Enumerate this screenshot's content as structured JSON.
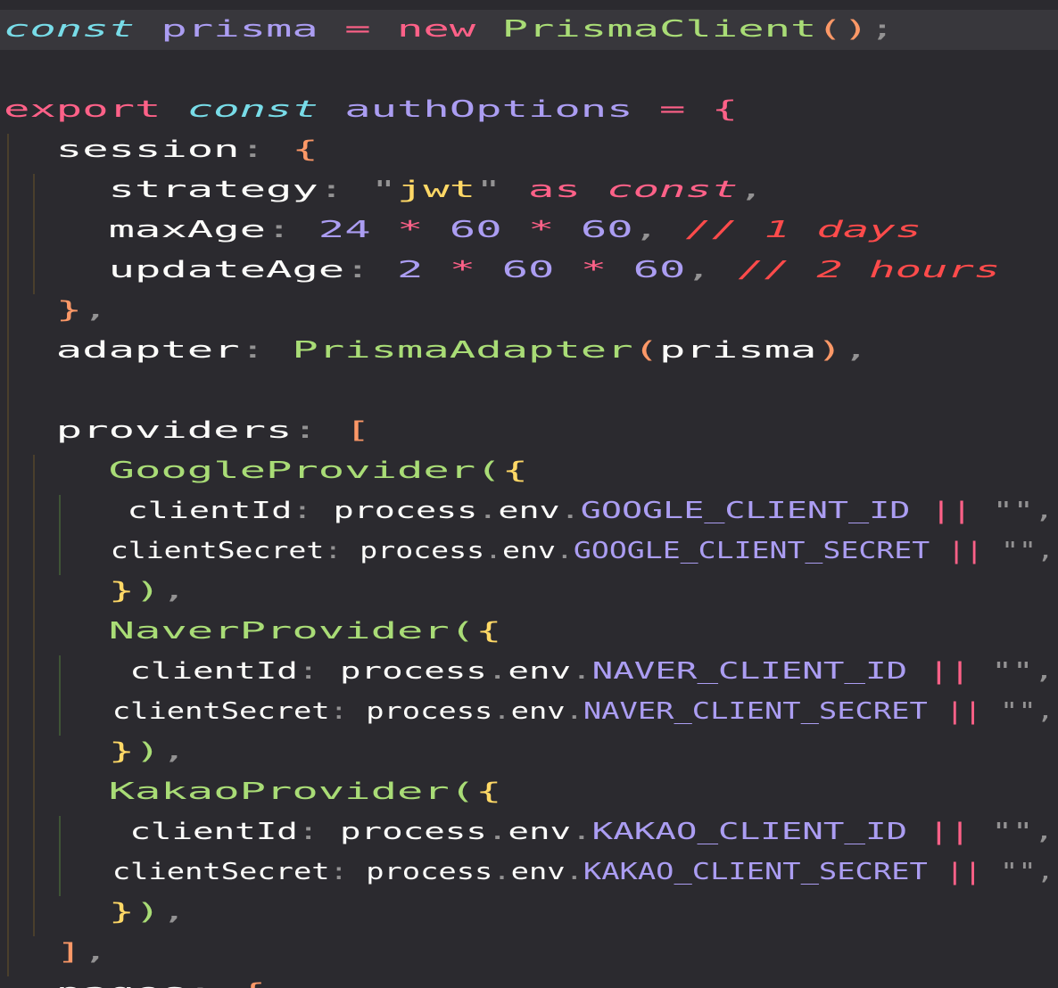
{
  "editor": {
    "colors": {
      "background": "#2b2a2f",
      "current_line": "#38373c",
      "keyword": "#ff6188",
      "storage": "#78dce8",
      "function": "#a9dc76",
      "string": "#ffd866",
      "constant": "#ab9df2",
      "punctuation": "#939293",
      "comment": "#ff4b4b",
      "bracket_level_1": "#fc9867",
      "bracket_level_2": "#a9dc76",
      "bracket_level_3": "#ffd866"
    },
    "lines": [
      {
        "text": "const prisma = new PrismaClient();",
        "active": true,
        "tokens": [
          {
            "t": "const",
            "c": "c-cyan italic"
          },
          {
            "t": " ",
            "c": ""
          },
          {
            "t": "prisma",
            "c": "c-purple"
          },
          {
            "t": " = ",
            "c": "c-pink"
          },
          {
            "t": "new",
            "c": "c-pink"
          },
          {
            "t": " ",
            "c": ""
          },
          {
            "t": "PrismaClient",
            "c": "c-green"
          },
          {
            "t": "()",
            "c": "c-orange"
          },
          {
            "t": ";",
            "c": "c-gray"
          }
        ]
      },
      {
        "text": "",
        "tokens": []
      },
      {
        "text": "export const authOptions = {",
        "tokens": [
          {
            "t": "export",
            "c": "c-pink"
          },
          {
            "t": " ",
            "c": ""
          },
          {
            "t": "const",
            "c": "c-cyan italic"
          },
          {
            "t": " ",
            "c": ""
          },
          {
            "t": "authOptions",
            "c": "c-purple"
          },
          {
            "t": " = ",
            "c": "c-pink"
          },
          {
            "t": "{",
            "c": "c-pink"
          }
        ]
      },
      {
        "text": "  session: {",
        "tokens": [
          {
            "t": "  ",
            "c": ""
          },
          {
            "t": "session",
            "c": "c-white"
          },
          {
            "t": ": ",
            "c": "c-gray"
          },
          {
            "t": "{",
            "c": "c-orange"
          }
        ]
      },
      {
        "text": "    strategy: \"jwt\" as const,",
        "tokens": [
          {
            "t": "    ",
            "c": ""
          },
          {
            "t": "strategy",
            "c": "c-white"
          },
          {
            "t": ": ",
            "c": "c-gray"
          },
          {
            "t": "\"",
            "c": "c-gray"
          },
          {
            "t": "jwt",
            "c": "c-yellow"
          },
          {
            "t": "\"",
            "c": "c-gray"
          },
          {
            "t": " ",
            "c": ""
          },
          {
            "t": "as",
            "c": "c-pink"
          },
          {
            "t": " ",
            "c": ""
          },
          {
            "t": "const",
            "c": "c-pink italic"
          },
          {
            "t": ",",
            "c": "c-gray"
          }
        ]
      },
      {
        "text": "    maxAge: 24 * 60 * 60, // 1 days",
        "tokens": [
          {
            "t": "    ",
            "c": ""
          },
          {
            "t": "maxAge",
            "c": "c-white"
          },
          {
            "t": ": ",
            "c": "c-gray"
          },
          {
            "t": "24",
            "c": "c-purple"
          },
          {
            "t": " * ",
            "c": "c-pink"
          },
          {
            "t": "60",
            "c": "c-purple"
          },
          {
            "t": " * ",
            "c": "c-pink"
          },
          {
            "t": "60",
            "c": "c-purple"
          },
          {
            "t": ", ",
            "c": "c-gray"
          },
          {
            "t": "// 1 days",
            "c": "c-red italic"
          }
        ]
      },
      {
        "text": "    updateAge: 2 * 60 * 60, // 2 hours",
        "tokens": [
          {
            "t": "    ",
            "c": ""
          },
          {
            "t": "updateAge",
            "c": "c-white"
          },
          {
            "t": ": ",
            "c": "c-gray"
          },
          {
            "t": "2",
            "c": "c-purple"
          },
          {
            "t": " * ",
            "c": "c-pink"
          },
          {
            "t": "60",
            "c": "c-purple"
          },
          {
            "t": " * ",
            "c": "c-pink"
          },
          {
            "t": "60",
            "c": "c-purple"
          },
          {
            "t": ", ",
            "c": "c-gray"
          },
          {
            "t": "// 2 hours",
            "c": "c-red italic"
          }
        ]
      },
      {
        "text": "  },",
        "tokens": [
          {
            "t": "  ",
            "c": ""
          },
          {
            "t": "}",
            "c": "c-orange"
          },
          {
            "t": ",",
            "c": "c-gray"
          }
        ]
      },
      {
        "text": "  adapter: PrismaAdapter(prisma),",
        "tokens": [
          {
            "t": "  ",
            "c": ""
          },
          {
            "t": "adapter",
            "c": "c-white"
          },
          {
            "t": ": ",
            "c": "c-gray"
          },
          {
            "t": "PrismaAdapter",
            "c": "c-green"
          },
          {
            "t": "(",
            "c": "c-orange"
          },
          {
            "t": "prisma",
            "c": "c-white"
          },
          {
            "t": ")",
            "c": "c-orange"
          },
          {
            "t": ",",
            "c": "c-gray"
          }
        ]
      },
      {
        "text": "",
        "tokens": []
      },
      {
        "text": "  providers: [",
        "tokens": [
          {
            "t": "  ",
            "c": ""
          },
          {
            "t": "providers",
            "c": "c-white"
          },
          {
            "t": ": ",
            "c": "c-gray"
          },
          {
            "t": "[",
            "c": "c-orange"
          }
        ]
      },
      {
        "text": "    GoogleProvider({",
        "tokens": [
          {
            "t": "    ",
            "c": ""
          },
          {
            "t": "GoogleProvider",
            "c": "c-green"
          },
          {
            "t": "(",
            "c": "c-green"
          },
          {
            "t": "{",
            "c": "c-yellow"
          }
        ]
      },
      {
        "text": "      clientId: process.env.GOOGLE_CLIENT_ID || \"\",",
        "tokens": [
          {
            "t": "      ",
            "c": ""
          },
          {
            "t": "clientId",
            "c": "c-white"
          },
          {
            "t": ": ",
            "c": "c-gray"
          },
          {
            "t": "process",
            "c": "c-white"
          },
          {
            "t": ".",
            "c": "c-gray"
          },
          {
            "t": "env",
            "c": "c-white"
          },
          {
            "t": ".",
            "c": "c-gray"
          },
          {
            "t": "GOOGLE_CLIENT_ID",
            "c": "c-purple"
          },
          {
            "t": " ",
            "c": ""
          },
          {
            "t": "||",
            "c": "c-pink"
          },
          {
            "t": " ",
            "c": ""
          },
          {
            "t": "\"\"",
            "c": "c-gray"
          },
          {
            "t": ",",
            "c": "c-gray"
          }
        ]
      },
      {
        "text": "      clientSecret: process.env.GOOGLE_CLIENT_SECRET || \"\",",
        "tokens": [
          {
            "t": "      ",
            "c": ""
          },
          {
            "t": "clientSecret",
            "c": "c-white"
          },
          {
            "t": ": ",
            "c": "c-gray"
          },
          {
            "t": "process",
            "c": "c-white"
          },
          {
            "t": ".",
            "c": "c-gray"
          },
          {
            "t": "env",
            "c": "c-white"
          },
          {
            "t": ".",
            "c": "c-gray"
          },
          {
            "t": "GOOGLE_CLIENT_SECRET",
            "c": "c-purple"
          },
          {
            "t": " ",
            "c": ""
          },
          {
            "t": "||",
            "c": "c-pink"
          },
          {
            "t": " ",
            "c": ""
          },
          {
            "t": "\"\"",
            "c": "c-gray"
          },
          {
            "t": ",",
            "c": "c-gray"
          }
        ]
      },
      {
        "text": "    }),",
        "tokens": [
          {
            "t": "    ",
            "c": ""
          },
          {
            "t": "}",
            "c": "c-yellow"
          },
          {
            "t": ")",
            "c": "c-green"
          },
          {
            "t": ",",
            "c": "c-gray"
          }
        ]
      },
      {
        "text": "    NaverProvider({",
        "tokens": [
          {
            "t": "    ",
            "c": ""
          },
          {
            "t": "NaverProvider",
            "c": "c-green"
          },
          {
            "t": "(",
            "c": "c-green"
          },
          {
            "t": "{",
            "c": "c-yellow"
          }
        ]
      },
      {
        "text": "      clientId: process.env.NAVER_CLIENT_ID || \"\",",
        "tokens": [
          {
            "t": "      ",
            "c": ""
          },
          {
            "t": "clientId",
            "c": "c-white"
          },
          {
            "t": ": ",
            "c": "c-gray"
          },
          {
            "t": "process",
            "c": "c-white"
          },
          {
            "t": ".",
            "c": "c-gray"
          },
          {
            "t": "env",
            "c": "c-white"
          },
          {
            "t": ".",
            "c": "c-gray"
          },
          {
            "t": "NAVER_CLIENT_ID",
            "c": "c-purple"
          },
          {
            "t": " ",
            "c": ""
          },
          {
            "t": "||",
            "c": "c-pink"
          },
          {
            "t": " ",
            "c": ""
          },
          {
            "t": "\"\"",
            "c": "c-gray"
          },
          {
            "t": ",",
            "c": "c-gray"
          }
        ]
      },
      {
        "text": "      clientSecret: process.env.NAVER_CLIENT_SECRET || \"\",",
        "tokens": [
          {
            "t": "      ",
            "c": ""
          },
          {
            "t": "clientSecret",
            "c": "c-white"
          },
          {
            "t": ": ",
            "c": "c-gray"
          },
          {
            "t": "process",
            "c": "c-white"
          },
          {
            "t": ".",
            "c": "c-gray"
          },
          {
            "t": "env",
            "c": "c-white"
          },
          {
            "t": ".",
            "c": "c-gray"
          },
          {
            "t": "NAVER_CLIENT_SECRET",
            "c": "c-purple"
          },
          {
            "t": " ",
            "c": ""
          },
          {
            "t": "||",
            "c": "c-pink"
          },
          {
            "t": " ",
            "c": ""
          },
          {
            "t": "\"\"",
            "c": "c-gray"
          },
          {
            "t": ",",
            "c": "c-gray"
          }
        ]
      },
      {
        "text": "    }),",
        "tokens": [
          {
            "t": "    ",
            "c": ""
          },
          {
            "t": "}",
            "c": "c-yellow"
          },
          {
            "t": ")",
            "c": "c-green"
          },
          {
            "t": ",",
            "c": "c-gray"
          }
        ]
      },
      {
        "text": "    KakaoProvider({",
        "tokens": [
          {
            "t": "    ",
            "c": ""
          },
          {
            "t": "KakaoProvider",
            "c": "c-green"
          },
          {
            "t": "(",
            "c": "c-green"
          },
          {
            "t": "{",
            "c": "c-yellow"
          }
        ]
      },
      {
        "text": "      clientId: process.env.KAKAO_CLIENT_ID || \"\",",
        "tokens": [
          {
            "t": "      ",
            "c": ""
          },
          {
            "t": "clientId",
            "c": "c-white"
          },
          {
            "t": ": ",
            "c": "c-gray"
          },
          {
            "t": "process",
            "c": "c-white"
          },
          {
            "t": ".",
            "c": "c-gray"
          },
          {
            "t": "env",
            "c": "c-white"
          },
          {
            "t": ".",
            "c": "c-gray"
          },
          {
            "t": "KAKAO_CLIENT_ID",
            "c": "c-purple"
          },
          {
            "t": " ",
            "c": ""
          },
          {
            "t": "||",
            "c": "c-pink"
          },
          {
            "t": " ",
            "c": ""
          },
          {
            "t": "\"\"",
            "c": "c-gray"
          },
          {
            "t": ",",
            "c": "c-gray"
          }
        ]
      },
      {
        "text": "      clientSecret: process.env.KAKAO_CLIENT_SECRET || \"\",",
        "tokens": [
          {
            "t": "      ",
            "c": ""
          },
          {
            "t": "clientSecret",
            "c": "c-white"
          },
          {
            "t": ": ",
            "c": "c-gray"
          },
          {
            "t": "process",
            "c": "c-white"
          },
          {
            "t": ".",
            "c": "c-gray"
          },
          {
            "t": "env",
            "c": "c-white"
          },
          {
            "t": ".",
            "c": "c-gray"
          },
          {
            "t": "KAKAO_CLIENT_SECRET",
            "c": "c-purple"
          },
          {
            "t": " ",
            "c": ""
          },
          {
            "t": "||",
            "c": "c-pink"
          },
          {
            "t": " ",
            "c": ""
          },
          {
            "t": "\"\"",
            "c": "c-gray"
          },
          {
            "t": ",",
            "c": "c-gray"
          }
        ]
      },
      {
        "text": "    }),",
        "tokens": [
          {
            "t": "    ",
            "c": ""
          },
          {
            "t": "}",
            "c": "c-yellow"
          },
          {
            "t": ")",
            "c": "c-green"
          },
          {
            "t": ",",
            "c": "c-gray"
          }
        ]
      },
      {
        "text": "  ],",
        "tokens": [
          {
            "t": "  ",
            "c": ""
          },
          {
            "t": "]",
            "c": "c-orange"
          },
          {
            "t": ",",
            "c": "c-gray"
          }
        ]
      },
      {
        "text": "  pages: {",
        "tokens": [
          {
            "t": "  ",
            "c": ""
          },
          {
            "t": "pages",
            "c": "c-white"
          },
          {
            "t": ": ",
            "c": "c-gray"
          },
          {
            "t": "{",
            "c": "c-orange"
          }
        ]
      }
    ]
  }
}
